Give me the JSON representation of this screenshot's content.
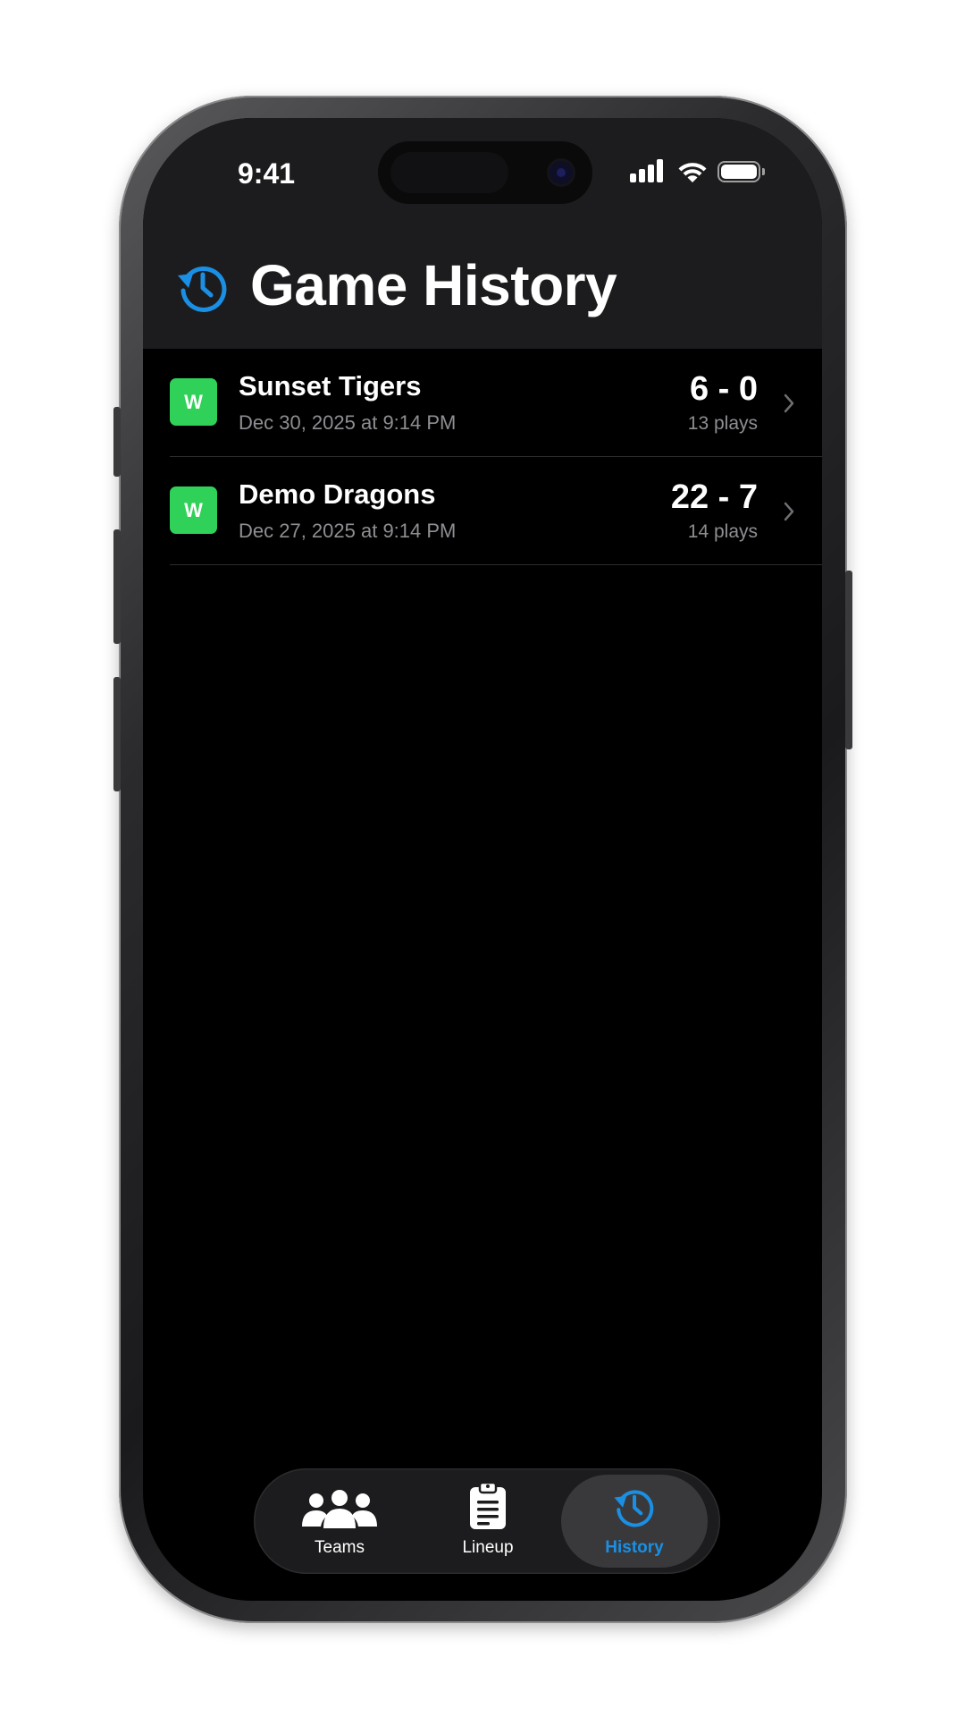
{
  "status_bar": {
    "time": "9:41"
  },
  "header": {
    "title": "Game History",
    "icon": "clock-history-icon"
  },
  "games": [
    {
      "result": "W",
      "opponent": "Sunset Tigers",
      "date": "Dec 30, 2025 at 9:14 PM",
      "score": "6 - 0",
      "plays": "13 plays"
    },
    {
      "result": "W",
      "opponent": "Demo Dragons",
      "date": "Dec 27, 2025 at 9:14 PM",
      "score": "22 - 7",
      "plays": "14 plays"
    }
  ],
  "tabs": [
    {
      "label": "Teams",
      "icon": "people-icon",
      "active": false
    },
    {
      "label": "Lineup",
      "icon": "clipboard-icon",
      "active": false
    },
    {
      "label": "History",
      "icon": "clock-history-icon",
      "active": true
    }
  ],
  "colors": {
    "accent": "#1a8fe3",
    "win_badge": "#30d158",
    "background": "#000000",
    "header_background": "#1c1c1e",
    "secondary_text": "#8e8e93"
  }
}
